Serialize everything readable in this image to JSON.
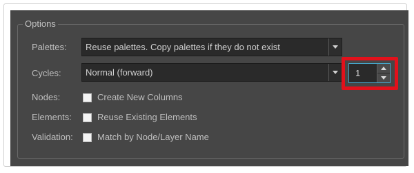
{
  "options": {
    "title": "Options",
    "palettes": {
      "label": "Palettes:",
      "value": "Reuse palettes. Copy palettes if they do not exist"
    },
    "cycles": {
      "label": "Cycles:",
      "value": "Normal (forward)",
      "count": "1"
    },
    "nodes": {
      "label": "Nodes:",
      "checkbox_label": "Create New Columns",
      "checked": false
    },
    "elements": {
      "label": "Elements:",
      "checkbox_label": "Reuse Existing Elements",
      "checked": false
    },
    "validation": {
      "label": "Validation:",
      "checkbox_label": "Match by Node/Layer Name",
      "checked": false
    }
  },
  "colors": {
    "panel_background": "#464646",
    "highlight_border": "#e2111b",
    "focus_border": "#46a3c7"
  }
}
